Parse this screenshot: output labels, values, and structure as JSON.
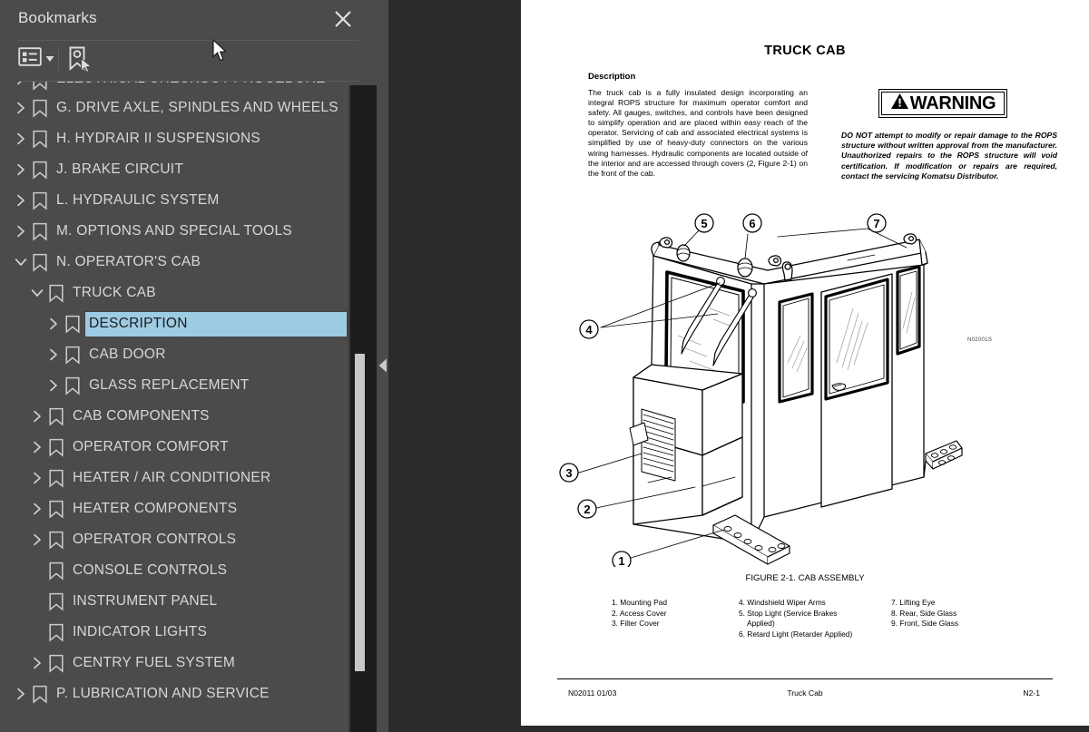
{
  "sidebar": {
    "title": "Bookmarks",
    "close_icon": "close-icon",
    "toolbar": {
      "options_icon": "list-options-icon",
      "options_caret": "chevron-down-icon",
      "new_bookmark_icon": "new-bookmark-icon"
    },
    "colors": {
      "panel_bg": "#4b4b4b",
      "text": "#d7d7d7",
      "selection_bg": "#9ecbe4",
      "viewer_bg": "#2b2b2b",
      "scrollbar_track": "#1c1c1c",
      "scrollbar_thumb": "#c8c8c8"
    },
    "tree": [
      {
        "label": "ELECTRICAL CHECKOUT PROCEDURE",
        "level": 0,
        "twisty": "collapsed",
        "partial": true
      },
      {
        "label": "G. DRIVE AXLE, SPINDLES AND WHEELS",
        "level": 0,
        "twisty": "collapsed"
      },
      {
        "label": "H. HYDRAIR II SUSPENSIONS",
        "level": 0,
        "twisty": "collapsed"
      },
      {
        "label": "J. BRAKE CIRCUIT",
        "level": 0,
        "twisty": "collapsed"
      },
      {
        "label": "L. HYDRAULIC SYSTEM",
        "level": 0,
        "twisty": "collapsed"
      },
      {
        "label": "M. OPTIONS AND SPECIAL TOOLS",
        "level": 0,
        "twisty": "collapsed"
      },
      {
        "label": "N. OPERATOR'S CAB",
        "level": 0,
        "twisty": "expanded"
      },
      {
        "label": "TRUCK CAB",
        "level": 1,
        "twisty": "expanded"
      },
      {
        "label": "DESCRIPTION",
        "level": 2,
        "twisty": "collapsed",
        "selected": true
      },
      {
        "label": "CAB DOOR",
        "level": 2,
        "twisty": "collapsed"
      },
      {
        "label": "GLASS REPLACEMENT",
        "level": 2,
        "twisty": "collapsed"
      },
      {
        "label": "CAB COMPONENTS",
        "level": 1,
        "twisty": "collapsed"
      },
      {
        "label": "OPERATOR COMFORT",
        "level": 1,
        "twisty": "collapsed"
      },
      {
        "label": "HEATER / AIR CONDITIONER",
        "level": 1,
        "twisty": "collapsed"
      },
      {
        "label": "HEATER COMPONENTS",
        "level": 1,
        "twisty": "collapsed"
      },
      {
        "label": "OPERATOR CONTROLS",
        "level": 1,
        "twisty": "collapsed"
      },
      {
        "label": "CONSOLE CONTROLS",
        "level": 1,
        "twisty": "none"
      },
      {
        "label": "INSTRUMENT PANEL",
        "level": 1,
        "twisty": "none"
      },
      {
        "label": "INDICATOR LIGHTS",
        "level": 1,
        "twisty": "none"
      },
      {
        "label": "CENTRY FUEL SYSTEM",
        "level": 1,
        "twisty": "collapsed"
      },
      {
        "label": "P. LUBRICATION AND SERVICE",
        "level": 0,
        "twisty": "collapsed"
      }
    ]
  },
  "viewer": {
    "collapse_handle_icon": "triangle-left-icon"
  },
  "document": {
    "title": "TRUCK CAB",
    "description_heading": "Description",
    "description_body": "The truck cab is a fully insulated design incorporating an integral ROPS structure for maximum operator comfort and safety. All gauges, switches, and controls have been designed to simplify operation and are placed within easy reach of the operator. Servicing of cab and associated electrical systems is simplified by use of heavy-duty connectors on the various wiring harnesses. Hydraulic components are located outside of the interior and are accessed through covers (2, Figure 2-1) on the front of the cab.",
    "warning": {
      "label": "WARNING",
      "icon": "warning-triangle-icon",
      "body": "DO NOT attempt to modify or repair damage to the ROPS structure without written approval from the manufacturer. Unauthorized repairs to the ROPS structure will void certification. If modification or repairs are required, contact the servicing Komatsu Distributor."
    },
    "figure": {
      "caption": "FIGURE 2-1. CAB ASSEMBLY",
      "drawing_id": "N02001S",
      "callouts": [
        "1",
        "2",
        "3",
        "4",
        "5",
        "6",
        "7"
      ],
      "legend_columns": [
        [
          "1. Mounting Pad",
          "2. Access Cover",
          "3. Filter Cover"
        ],
        [
          "4. Windshield Wiper Arms",
          "5. Stop Light (Service Brakes",
          "Applied)",
          "6. Retard Light (Retarder Applied)"
        ],
        [
          "7. Lifting Eye",
          "8. Rear, Side Glass",
          "9. Front, Side Glass"
        ]
      ]
    },
    "footer": {
      "left": "N02011  01/03",
      "center": "Truck Cab",
      "right": "N2-1"
    }
  }
}
